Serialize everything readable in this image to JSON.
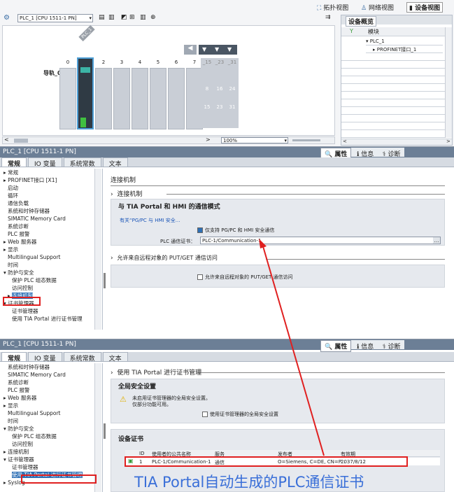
{
  "top_tabs": {
    "topology": "拓扑视图",
    "network": "网络视图",
    "device": "设备视图"
  },
  "toolbar": {
    "device_select": "PLC_1 [CPU 1511-1 PN]"
  },
  "device_view": {
    "plc_tag": "PLC_1",
    "rail_label": "导轨_0",
    "slot_numbers": [
      "0",
      "1",
      "2",
      "3",
      "4",
      "5",
      "6",
      "7"
    ],
    "extra_slots_top": [
      "_15",
      "_23",
      "_31"
    ],
    "extra_slots_row1": [
      "8",
      "16",
      "24"
    ],
    "extra_slots_row2": [
      "15",
      "23",
      "31"
    ],
    "zoom": "100%"
  },
  "overview": {
    "title": "设备概览",
    "col_module": "模块",
    "rows": [
      "PLC_1",
      "PROFINET接口_1"
    ]
  },
  "props1": {
    "title": "PLC_1 [CPU 1511-1 PN]",
    "right_tabs": {
      "props": "属性",
      "info": "信息",
      "diag": "诊断"
    },
    "tabs": [
      "常规",
      "IO 变量",
      "系统常数",
      "文本"
    ],
    "tree": [
      "常规",
      "PROFINET接口 [X1]",
      "启动",
      "循环",
      "通信负载",
      "系统和时钟存储器",
      "SIMATIC Memory Card",
      "系统诊断",
      "PLC 报警",
      "Web 服务器",
      "显示",
      "Multilingual Support",
      "时间",
      "防护与安全",
      "保护 PLC 组态数据",
      "访问控制",
      "连接机制",
      "证书管理器",
      "证书管理器",
      "使用 TIA Portal 进行证书管理"
    ],
    "heading": "连接机制",
    "section1": "连接机制",
    "subsection": "与 TIA Portal 和 HMI 的通信模式",
    "link": "有关“PG/PC 与 HMI 安全...",
    "checkbox1": "仅支持 PG/PC 和 HMI 安全通信",
    "cert_label": "PLC 通信证书：",
    "cert_value": "PLC-1/Communication-1",
    "section2": "允许来自远程对象的 PUT/GET 通信访问",
    "checkbox2": "允许来自远程对象的 PUT/GET 通信访问"
  },
  "props2": {
    "title": "PLC_1 [CPU 1511-1 PN]",
    "right_tabs": {
      "props": "属性",
      "info": "信息",
      "diag": "诊断"
    },
    "tabs": [
      "常规",
      "IO 变量",
      "系统常数",
      "文本"
    ],
    "tree": [
      "系统和时钟存储器",
      "SIMATIC Memory Card",
      "系统诊断",
      "PLC 报警",
      "Web 服务器",
      "显示",
      "Multilingual Support",
      "时间",
      "防护与安全",
      "保护 PLC 组态数据",
      "访问控制",
      "连接机制",
      "证书管理器",
      "证书管理器",
      "使用 TIA Portal 进行证书管理",
      "Syslog"
    ],
    "section": "使用 TIA Portal 进行证书管理",
    "global_title": "全局安全设置",
    "warning": "未启用证书管理器的全局安全设置。\n仅部分功能可用。",
    "checkbox": "使用证书管理器的全局安全设置",
    "device_cert_title": "设备证书",
    "table_headers": [
      "ID",
      "使用者的公共名称",
      "服务",
      "发布者",
      "有效期"
    ],
    "table_row": [
      "1",
      "PLC-1/Communication-1",
      "通信",
      "O=Siemens, C=DE, CN=P...",
      "2037/8/12"
    ],
    "caption": "TIA Portal自动生成的PLC通信证书"
  },
  "colors": {
    "accent": "#e02020",
    "caption": "#3a6fd8",
    "title_bar": "#6c7f96"
  }
}
